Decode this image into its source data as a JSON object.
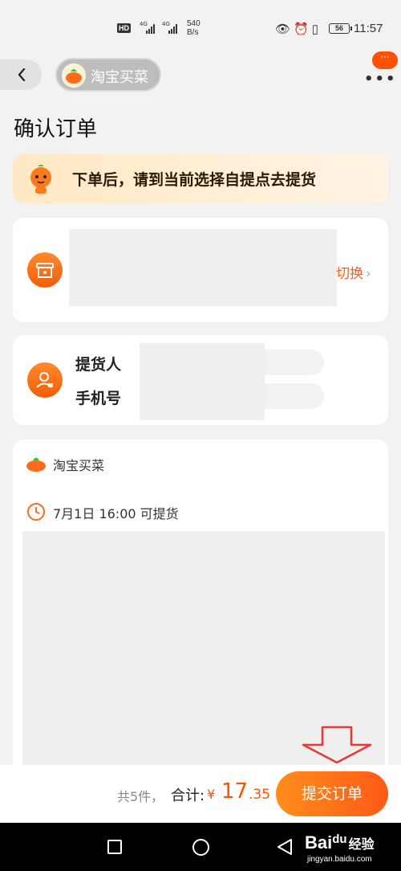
{
  "status_bar": {
    "hd_badge": "HD",
    "sim1": "4G",
    "sim2": "4G",
    "speed_value": "540",
    "speed_unit": "B/s",
    "battery": "56",
    "time": "11:57"
  },
  "header": {
    "app_name": "淘宝买菜",
    "notification_badge": "···"
  },
  "page_title": "确认订单",
  "notice": "下单后，请到当前选择自提点去提货",
  "store_card": {
    "switch_label": "切换"
  },
  "contact_card": {
    "pickup_person_label": "提货人",
    "phone_label": "手机号"
  },
  "order_card": {
    "shop_name": "淘宝买菜",
    "pickup_time": "7月1日 16:00 可提货"
  },
  "bottom_bar": {
    "count_text": "共5件，",
    "total_label": "合计:",
    "currency": "¥",
    "amount_int": "17",
    "amount_dec": ".35",
    "submit_label": "提交订单"
  },
  "watermark": {
    "brand_left": "Bai",
    "brand_mid": "du",
    "brand_cn": "经验",
    "url": "jingyan.baidu.com"
  },
  "colors": {
    "accent": "#ff5000",
    "notice_bg": "#ffe9c4",
    "annotation_arrow": "#e53935"
  }
}
